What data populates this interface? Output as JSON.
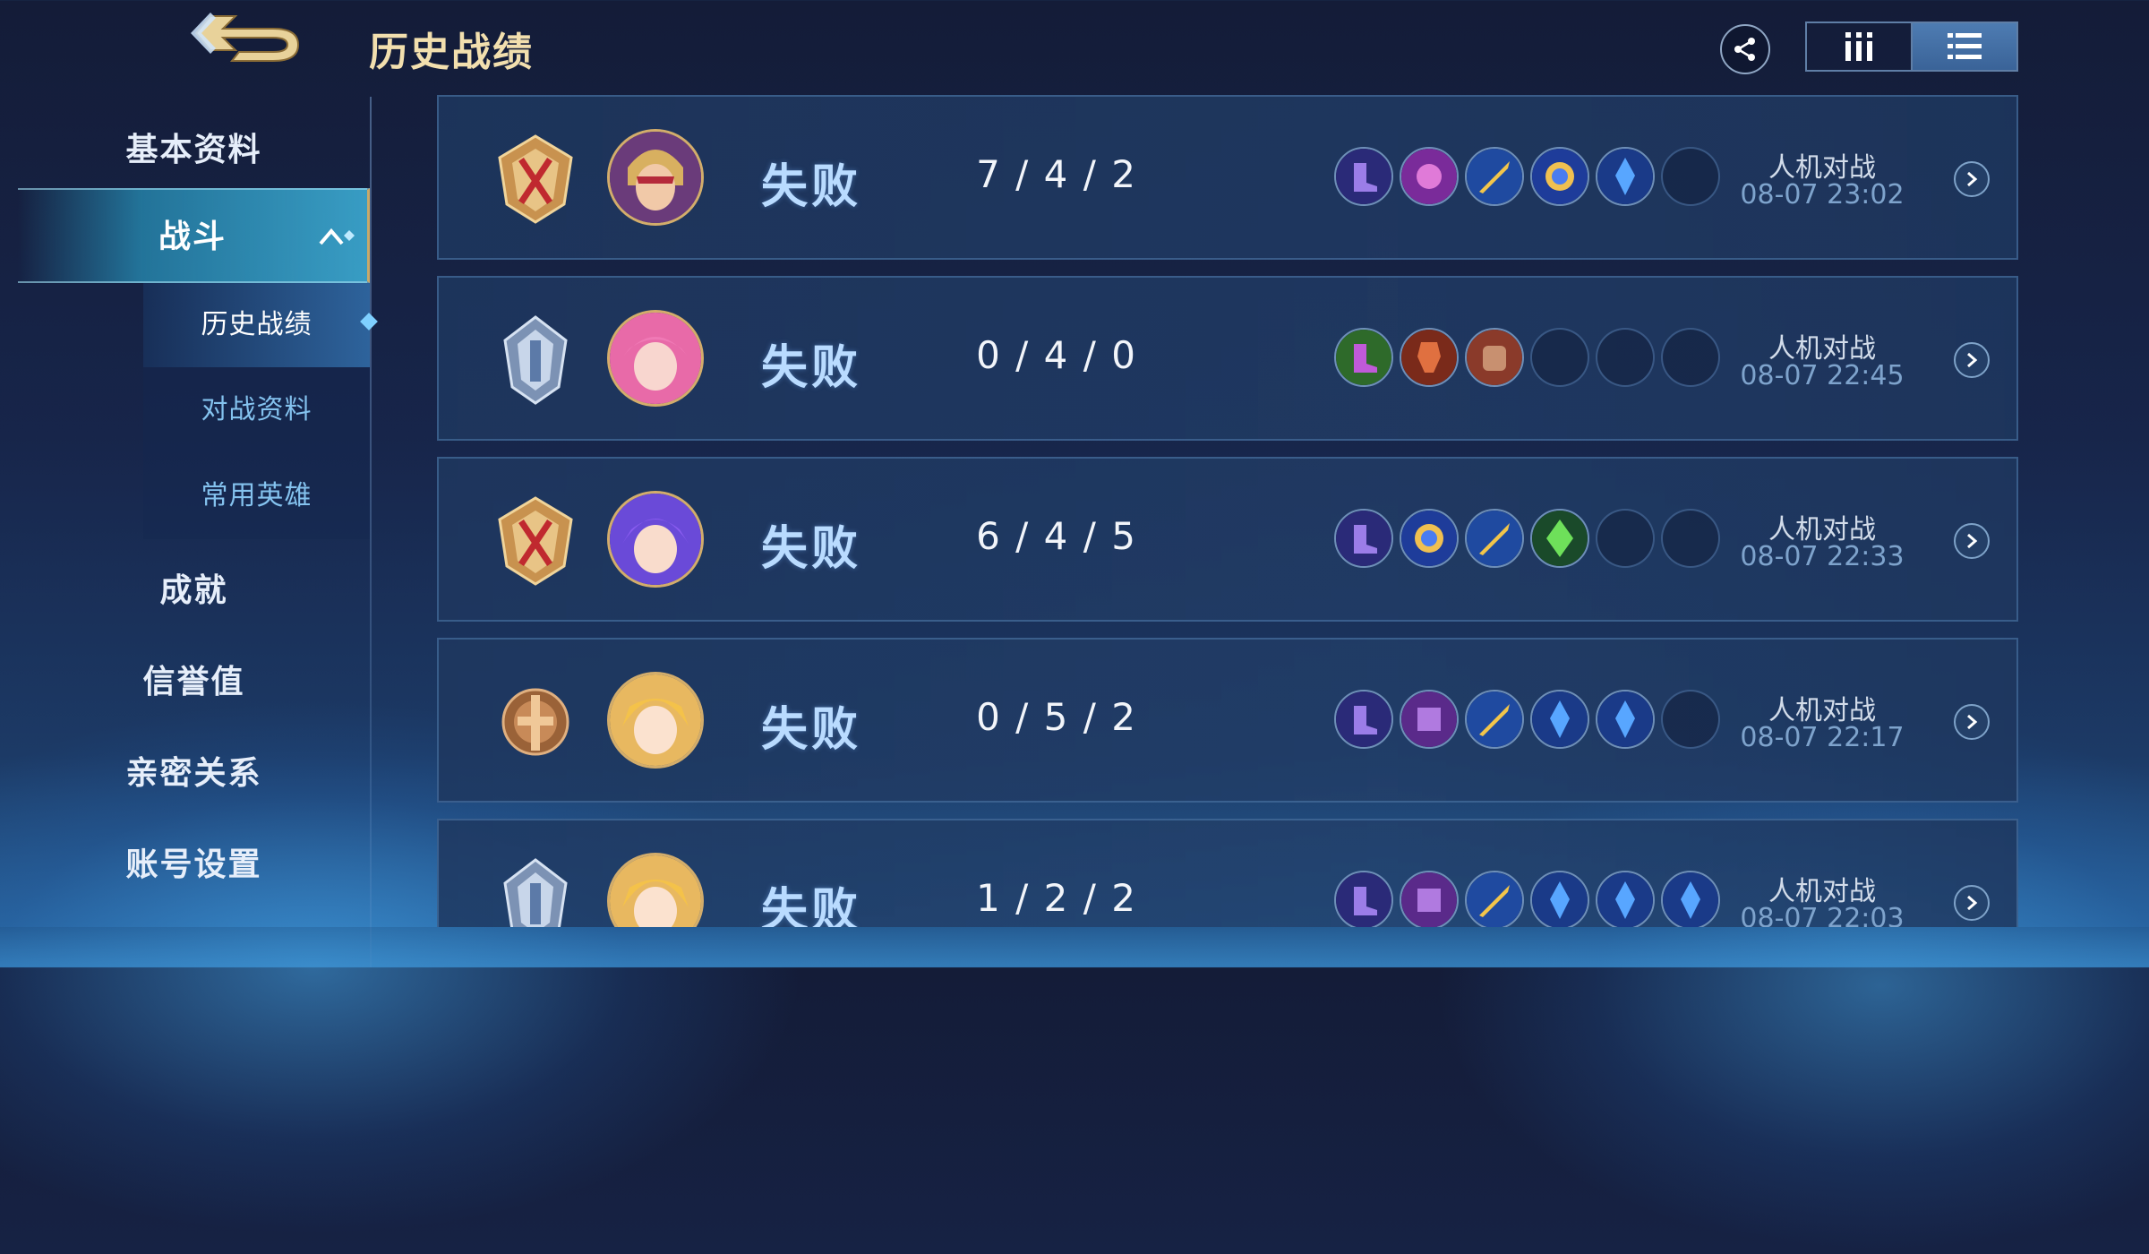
{
  "header": {
    "title": "历史战绩"
  },
  "sidebar": {
    "items": [
      {
        "label": "基本资料"
      },
      {
        "label": "战斗"
      },
      {
        "label": "成就"
      },
      {
        "label": "信誉值"
      },
      {
        "label": "亲密关系"
      },
      {
        "label": "账号设置"
      }
    ],
    "sub_items": [
      {
        "label": "历史战绩"
      },
      {
        "label": "对战资料"
      },
      {
        "label": "常用英雄"
      }
    ]
  },
  "matches": [
    {
      "result": "失败",
      "kda": "7 / 4 / 2",
      "mode": "人机对战",
      "time": "08-07 23:02"
    },
    {
      "result": "失败",
      "kda": "0 / 4 / 0",
      "mode": "人机对战",
      "time": "08-07 22:45"
    },
    {
      "result": "失败",
      "kda": "6 / 4 / 5",
      "mode": "人机对战",
      "time": "08-07 22:33"
    },
    {
      "result": "失败",
      "kda": "0 / 5 / 2",
      "mode": "人机对战",
      "time": "08-07 22:17"
    },
    {
      "result": "失败",
      "kda": "1 / 2 / 2",
      "mode": "人机对战",
      "time": "08-07 22:03"
    }
  ],
  "colors": {
    "title_gold": "#f2dfae",
    "result_blue": "#b9dbff",
    "accent_cyan": "#3fa9d6"
  }
}
